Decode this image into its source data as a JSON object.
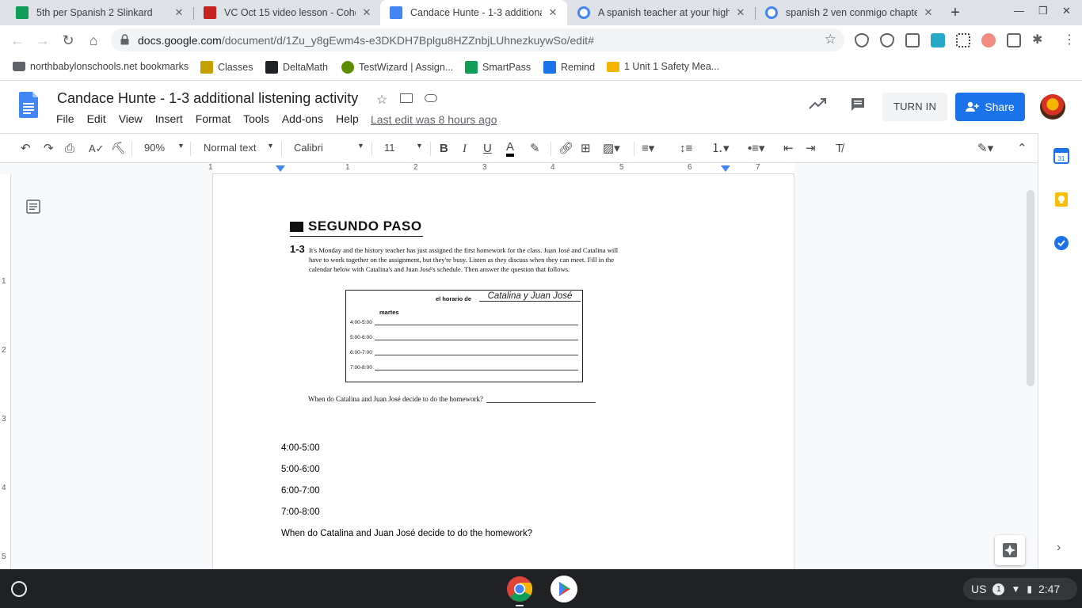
{
  "browser": {
    "tabs": [
      {
        "title": "5th per Spanish 2 Slinkard",
        "favicon": "google-classroom-icon",
        "color": "#0f9d58"
      },
      {
        "title": "VC Oct 15 video lesson - Cohort",
        "favicon": "clapperboard-icon",
        "color": "#c5221f"
      },
      {
        "title": "Candace Hunte - 1-3 additional",
        "favicon": "google-docs-icon",
        "color": "#4285f4",
        "active": true
      },
      {
        "title": "A spanish teacher at your high",
        "favicon": "google-search-icon",
        "color": "#4285f4"
      },
      {
        "title": "spanish 2 ven conmigo chapter",
        "favicon": "google-search-icon",
        "color": "#4285f4"
      }
    ],
    "address": {
      "host": "docs.google.com",
      "path": "/document/d/1Zu_y8gEwm4s-e3DKDH7Bplgu8HZZnbjLUhnezkuywSo/edit#"
    },
    "bookmarks": [
      {
        "label": "northbabylonschools.net bookmarks",
        "icon": "folder-icon",
        "color": "#5f6368"
      },
      {
        "label": "Classes",
        "icon": "classroom-icon",
        "color": "#c5a100"
      },
      {
        "label": "DeltaMath",
        "icon": "deltamath-icon",
        "color": "#202124"
      },
      {
        "label": "TestWizard | Assign...",
        "icon": "testwizard-icon",
        "color": "#5f8d00"
      },
      {
        "label": "SmartPass",
        "icon": "smartpass-icon",
        "color": "#0f9d58"
      },
      {
        "label": "Remind",
        "icon": "remind-icon",
        "color": "#1a73e8"
      },
      {
        "label": "1 Unit 1 Safety Mea...",
        "icon": "folder-yellow-icon",
        "color": "#f4b400"
      }
    ]
  },
  "docs": {
    "title": "Candace Hunte - 1-3 additional listening activity",
    "menu": [
      "File",
      "Edit",
      "View",
      "Insert",
      "Format",
      "Tools",
      "Add-ons",
      "Help"
    ],
    "last_edit": "Last edit was 8 hours ago",
    "turn_in_label": "TURN IN",
    "share_label": "Share",
    "toolbar": {
      "zoom": "90%",
      "style": "Normal text",
      "font": "Calibri",
      "size": "11"
    },
    "ruler_numbers": [
      "1",
      "1",
      "2",
      "3",
      "4",
      "5",
      "6",
      "7"
    ],
    "vruler_numbers": [
      "1",
      "2",
      "3",
      "4",
      "5"
    ]
  },
  "worksheet": {
    "heading": "SEGUNDO PASO",
    "number": "1-3",
    "instructions": "It's Monday and the history teacher has just assigned the first homework for the class. Juan José and Catalina will have to work together on the assignment, but they're busy. Listen as they discuss when they can meet. Fill in the calendar below with Catalina's and Juan José's schedule. Then answer the question that follows.",
    "schedule_label": "el horario de",
    "schedule_names": "Catalina y Juan José",
    "day": "martes",
    "slots": [
      "4:00-5:00",
      "5:00-6:00",
      "6:00-7:00",
      "7:00-8:00"
    ],
    "question": "When do Catalina and Juan José decide to do the homework?"
  },
  "document_body": {
    "lines": [
      "4:00-5:00",
      "5:00-6:00",
      "6:00-7:00",
      "7:00-8:00",
      "When do Catalina and Juan José decide to do the homework?"
    ]
  },
  "shelf": {
    "ime": "US",
    "notification_count": "1",
    "time": "2:47"
  },
  "colors": {
    "accent": "#1a73e8",
    "tabstrip": "#dee1e6",
    "shelf": "#202124"
  }
}
